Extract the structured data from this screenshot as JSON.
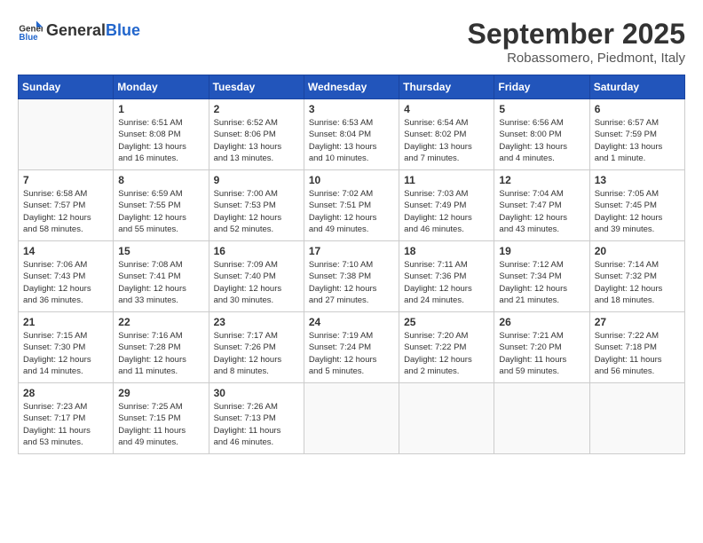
{
  "header": {
    "logo_general": "General",
    "logo_blue": "Blue",
    "title": "September 2025",
    "subtitle": "Robassomero, Piedmont, Italy"
  },
  "days_of_week": [
    "Sunday",
    "Monday",
    "Tuesday",
    "Wednesday",
    "Thursday",
    "Friday",
    "Saturday"
  ],
  "weeks": [
    [
      {
        "day": "",
        "info": ""
      },
      {
        "day": "1",
        "info": "Sunrise: 6:51 AM\nSunset: 8:08 PM\nDaylight: 13 hours\nand 16 minutes."
      },
      {
        "day": "2",
        "info": "Sunrise: 6:52 AM\nSunset: 8:06 PM\nDaylight: 13 hours\nand 13 minutes."
      },
      {
        "day": "3",
        "info": "Sunrise: 6:53 AM\nSunset: 8:04 PM\nDaylight: 13 hours\nand 10 minutes."
      },
      {
        "day": "4",
        "info": "Sunrise: 6:54 AM\nSunset: 8:02 PM\nDaylight: 13 hours\nand 7 minutes."
      },
      {
        "day": "5",
        "info": "Sunrise: 6:56 AM\nSunset: 8:00 PM\nDaylight: 13 hours\nand 4 minutes."
      },
      {
        "day": "6",
        "info": "Sunrise: 6:57 AM\nSunset: 7:59 PM\nDaylight: 13 hours\nand 1 minute."
      }
    ],
    [
      {
        "day": "7",
        "info": "Sunrise: 6:58 AM\nSunset: 7:57 PM\nDaylight: 12 hours\nand 58 minutes."
      },
      {
        "day": "8",
        "info": "Sunrise: 6:59 AM\nSunset: 7:55 PM\nDaylight: 12 hours\nand 55 minutes."
      },
      {
        "day": "9",
        "info": "Sunrise: 7:00 AM\nSunset: 7:53 PM\nDaylight: 12 hours\nand 52 minutes."
      },
      {
        "day": "10",
        "info": "Sunrise: 7:02 AM\nSunset: 7:51 PM\nDaylight: 12 hours\nand 49 minutes."
      },
      {
        "day": "11",
        "info": "Sunrise: 7:03 AM\nSunset: 7:49 PM\nDaylight: 12 hours\nand 46 minutes."
      },
      {
        "day": "12",
        "info": "Sunrise: 7:04 AM\nSunset: 7:47 PM\nDaylight: 12 hours\nand 43 minutes."
      },
      {
        "day": "13",
        "info": "Sunrise: 7:05 AM\nSunset: 7:45 PM\nDaylight: 12 hours\nand 39 minutes."
      }
    ],
    [
      {
        "day": "14",
        "info": "Sunrise: 7:06 AM\nSunset: 7:43 PM\nDaylight: 12 hours\nand 36 minutes."
      },
      {
        "day": "15",
        "info": "Sunrise: 7:08 AM\nSunset: 7:41 PM\nDaylight: 12 hours\nand 33 minutes."
      },
      {
        "day": "16",
        "info": "Sunrise: 7:09 AM\nSunset: 7:40 PM\nDaylight: 12 hours\nand 30 minutes."
      },
      {
        "day": "17",
        "info": "Sunrise: 7:10 AM\nSunset: 7:38 PM\nDaylight: 12 hours\nand 27 minutes."
      },
      {
        "day": "18",
        "info": "Sunrise: 7:11 AM\nSunset: 7:36 PM\nDaylight: 12 hours\nand 24 minutes."
      },
      {
        "day": "19",
        "info": "Sunrise: 7:12 AM\nSunset: 7:34 PM\nDaylight: 12 hours\nand 21 minutes."
      },
      {
        "day": "20",
        "info": "Sunrise: 7:14 AM\nSunset: 7:32 PM\nDaylight: 12 hours\nand 18 minutes."
      }
    ],
    [
      {
        "day": "21",
        "info": "Sunrise: 7:15 AM\nSunset: 7:30 PM\nDaylight: 12 hours\nand 14 minutes."
      },
      {
        "day": "22",
        "info": "Sunrise: 7:16 AM\nSunset: 7:28 PM\nDaylight: 12 hours\nand 11 minutes."
      },
      {
        "day": "23",
        "info": "Sunrise: 7:17 AM\nSunset: 7:26 PM\nDaylight: 12 hours\nand 8 minutes."
      },
      {
        "day": "24",
        "info": "Sunrise: 7:19 AM\nSunset: 7:24 PM\nDaylight: 12 hours\nand 5 minutes."
      },
      {
        "day": "25",
        "info": "Sunrise: 7:20 AM\nSunset: 7:22 PM\nDaylight: 12 hours\nand 2 minutes."
      },
      {
        "day": "26",
        "info": "Sunrise: 7:21 AM\nSunset: 7:20 PM\nDaylight: 11 hours\nand 59 minutes."
      },
      {
        "day": "27",
        "info": "Sunrise: 7:22 AM\nSunset: 7:18 PM\nDaylight: 11 hours\nand 56 minutes."
      }
    ],
    [
      {
        "day": "28",
        "info": "Sunrise: 7:23 AM\nSunset: 7:17 PM\nDaylight: 11 hours\nand 53 minutes."
      },
      {
        "day": "29",
        "info": "Sunrise: 7:25 AM\nSunset: 7:15 PM\nDaylight: 11 hours\nand 49 minutes."
      },
      {
        "day": "30",
        "info": "Sunrise: 7:26 AM\nSunset: 7:13 PM\nDaylight: 11 hours\nand 46 minutes."
      },
      {
        "day": "",
        "info": ""
      },
      {
        "day": "",
        "info": ""
      },
      {
        "day": "",
        "info": ""
      },
      {
        "day": "",
        "info": ""
      }
    ]
  ]
}
